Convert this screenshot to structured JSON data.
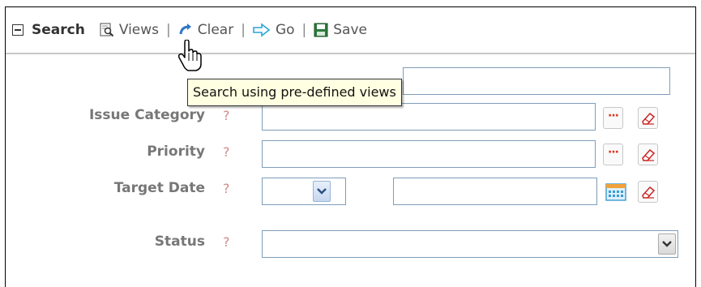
{
  "toolbar": {
    "title": "Search",
    "views_label": "Views",
    "clear_label": "Clear",
    "go_label": "Go",
    "save_label": "Save",
    "separator": "|"
  },
  "tooltip": {
    "text": "Search using pre-defined views"
  },
  "form": {
    "help_glyph": "?",
    "issue_category_label": "Issue Category",
    "priority_label": "Priority",
    "target_date_label": "Target Date",
    "status_label": "Status",
    "lookup_glyph": "···"
  },
  "icons": {
    "collapse": "minus-box-icon",
    "views": "magnifier-document-icon",
    "clear": "blue-curved-arrow-icon",
    "go": "right-arrow-icon",
    "save": "floppy-disk-icon",
    "lookup": "dots-icon",
    "eraser": "eraser-icon",
    "calendar": "calendar-icon",
    "dropdown": "chevron-down-icon",
    "cursor": "hand-pointer-icon"
  },
  "colors": {
    "label": "#777777",
    "help": "#d08a8a",
    "field_border": "#7f9db9",
    "tooltip_bg": "#ffffe1",
    "go_arrow": "#5bc0de"
  }
}
